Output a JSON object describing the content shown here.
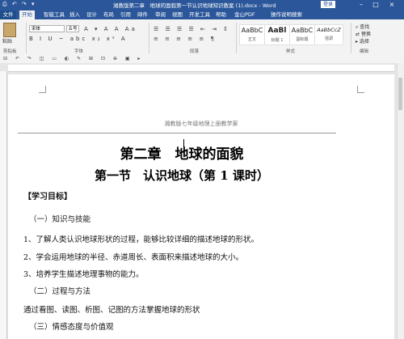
{
  "window": {
    "title": "湘教版第二章　地球的面貌第一节认识地球知识教案 (1).docx - Word",
    "login_label": "登录",
    "quick_access": "⎙ ↶ ↷ ▾"
  },
  "tabs": [
    "文件",
    "开始",
    "智能工具",
    "插入",
    "设计",
    "布局",
    "引用",
    "邮件",
    "审阅",
    "视图",
    "开发工具",
    "帮助",
    "金山PDF",
    "操作说明搜索"
  ],
  "ribbon": {
    "paste_label": "粘贴",
    "clipboard_label": "剪贴板",
    "font_name": "宋体",
    "font_size": "五号",
    "font_group_label": "字体",
    "format_row1": "B I U ~ abc x₂ x² A",
    "format_row2": "A ▾ A A Aa",
    "paragraph_row1": "☰ ☰ ☰ ☰ ⇤ ⇥ ↕",
    "paragraph_row2": "≡ ≡ ≡ ≡ ≡ ¶",
    "paragraph_label": "段落",
    "styles": [
      {
        "sample": "AaBbC",
        "name": "正文"
      },
      {
        "sample": "AaBl",
        "name": "标题 1"
      },
      {
        "sample": "AaBbC",
        "name": "副标题"
      },
      {
        "sample": "AaBbCcZ",
        "name": "强调"
      }
    ],
    "styles_label": "样式",
    "edit_items": [
      "查找",
      "替换",
      "选择"
    ],
    "edit_label": "编辑"
  },
  "qat2": "⊟ ↶ ↷ ◫ ▭ ◐ ✎ ⊞ ⊡ ⊕ ▣ ▸",
  "document": {
    "header": "湘教版七年级地理上册教学案",
    "chapter": "第二章　地球的面貌",
    "section": "第一节　认识地球（第 1 课时）",
    "lines": [
      {
        "text": "【学习目标】",
        "bold": true
      },
      {
        "text": "（一）知识与技能",
        "bold": false
      },
      {
        "text": "1、了解人类认识地球形状的过程，能够比较详细的描述地球的形状。",
        "bold": false
      },
      {
        "text": "2、学会运用地球的半径、赤道周长、表面积来描述地球的大小。",
        "bold": false
      },
      {
        "text": "3、培养学生描述地理事物的能力。",
        "bold": false
      },
      {
        "text": "（二）过程与方法",
        "bold": false
      },
      {
        "text": "通过看图、读图、析图、记图的方法掌握地球的形状",
        "bold": false
      },
      {
        "text": "（三）情感态度与价值观",
        "bold": false
      }
    ]
  },
  "colors": {
    "accent": "#2b579a"
  }
}
